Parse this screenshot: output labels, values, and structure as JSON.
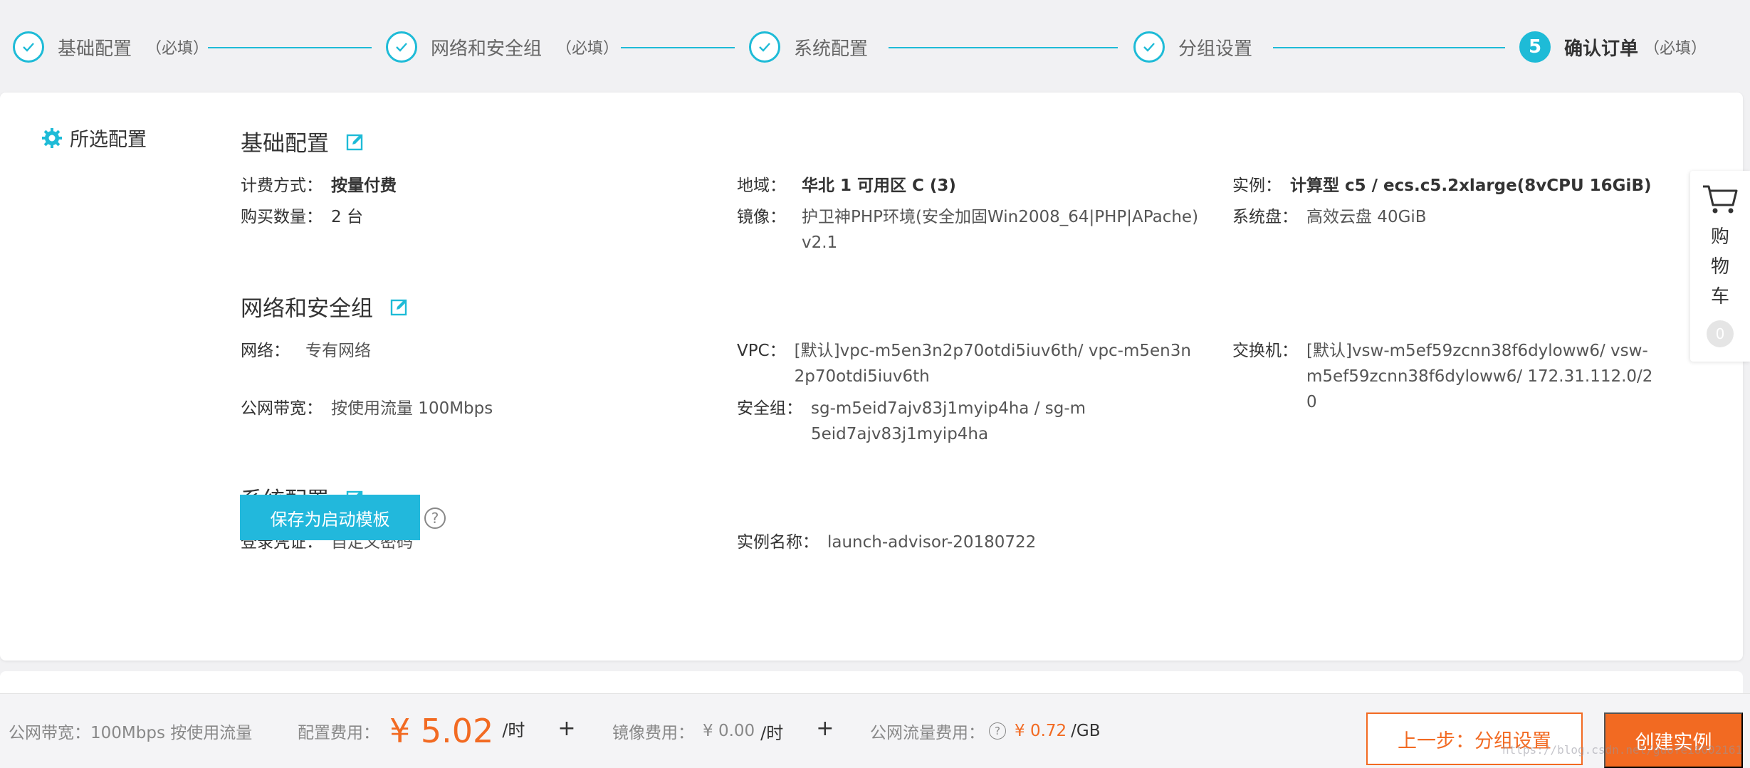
{
  "steps": [
    {
      "label": "基础配置",
      "required": "（必填）"
    },
    {
      "label": "网络和安全组",
      "required": "（必填）"
    },
    {
      "label": "系统配置"
    },
    {
      "label": "分组设置"
    },
    {
      "number": "5",
      "label": "确认订单",
      "required": "（必填）"
    }
  ],
  "config": {
    "title": "所选配置",
    "basic": {
      "title": "基础配置",
      "billing_label": "计费方式：",
      "billing_value": "按量付费",
      "region_label": "地域：",
      "region_value": "华北 1 可用区 C (3)",
      "instance_label": "实例：",
      "instance_value": "计算型 c5 / ecs.c5.2xlarge(8vCPU 16GiB)",
      "quantity_label": "购买数量：",
      "quantity_value": "2 台",
      "image_label": "镜像：",
      "image_value": "护卫神PHP环境(安全加固Win2008_64|PHP|APache) v2.1",
      "disk_label": "系统盘：",
      "disk_value": "高效云盘 40GiB"
    },
    "network": {
      "title": "网络和安全组",
      "net_label": "网络：",
      "net_value": "专有网络",
      "vpc_label": "VPC：",
      "vpc_value": "[默认]vpc-m5en3n2p70otdi5iuv6th/ vpc-m5en3n2p70otdi5iuv6th",
      "switch_label": "交换机：",
      "switch_value": "[默认]vsw-m5ef59zcnn38f6dyloww6/ vsw-m5ef59zcnn38f6dyloww6/ 172.31.112.0/20",
      "bandwidth_label": "公网带宽：",
      "bandwidth_value": "按使用流量 100Mbps",
      "sg_label": "安全组：",
      "sg_value": "sg-m5eid7ajv83j1myip4ha / sg-m5eid7ajv83j1myip4ha"
    },
    "system": {
      "title": "系统配置",
      "login_label": "登录凭证：",
      "login_value": "自定义密码",
      "name_label": "实例名称：",
      "name_value": "launch-advisor-20180722"
    },
    "save_template": "保存为启动模板",
    "help": "?"
  },
  "cart": {
    "label": "购物车",
    "count": "0"
  },
  "footer": {
    "bandwidth": "公网带宽：100Mbps 按使用流量",
    "config_fee_label": "配置费用：",
    "config_fee_value": "¥ 5.02",
    "config_fee_unit": "/时",
    "plus1": "+",
    "image_fee_label": "镜像费用：",
    "image_fee_value": "¥ 0.00",
    "image_fee_unit": "/时",
    "plus2": "+",
    "traffic_fee_label": "公网流量费用：",
    "traffic_help": "?",
    "traffic_fee_value": "¥ 0.72",
    "traffic_fee_unit": "/GB",
    "prev_button": "上一步：分组设置",
    "create_button": "创建实例"
  },
  "watermark": "https://blog.csdn.net/guofei8002161",
  "colors": {
    "accent": "#1ebbd7",
    "orange": "#f26a22"
  }
}
